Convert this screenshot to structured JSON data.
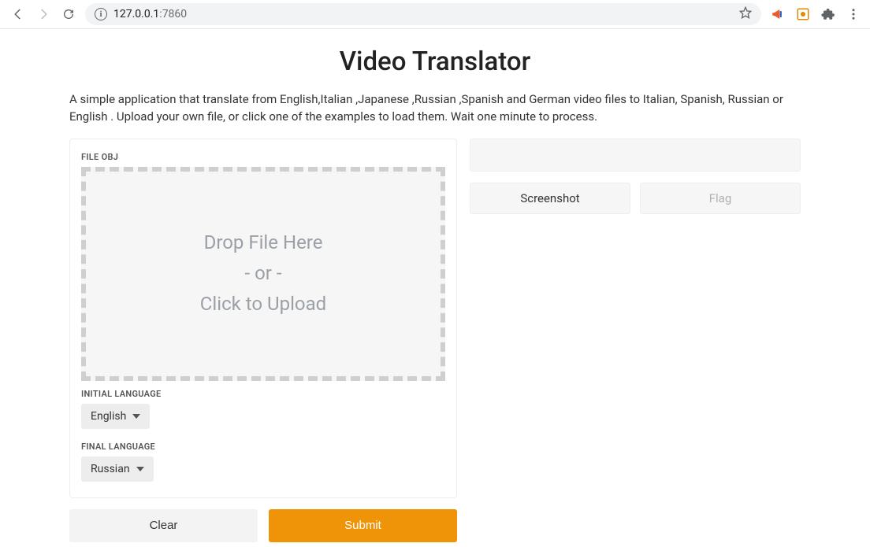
{
  "browser": {
    "url_host": "127.0.0.1",
    "url_port": ":7860"
  },
  "page": {
    "title": "Video Translator",
    "description": "A simple application that translate from English,Italian ,Japanese ,Russian ,Spanish and German video files to Italian, Spanish, Russian or English . Upload your own file, or click one of the examples to load them. Wait one minute to process."
  },
  "left": {
    "file_label": "FILE OBJ",
    "dropzone": {
      "line1": "Drop File Here",
      "line2": "- or -",
      "line3": "Click to Upload"
    },
    "initial_language_label": "INITIAL LANGUAGE",
    "initial_language_value": "English",
    "final_language_label": "FINAL LANGUAGE",
    "final_language_value": "Russian"
  },
  "actions": {
    "clear": "Clear",
    "submit": "Submit"
  },
  "right": {
    "screenshot": "Screenshot",
    "flag": "Flag"
  }
}
